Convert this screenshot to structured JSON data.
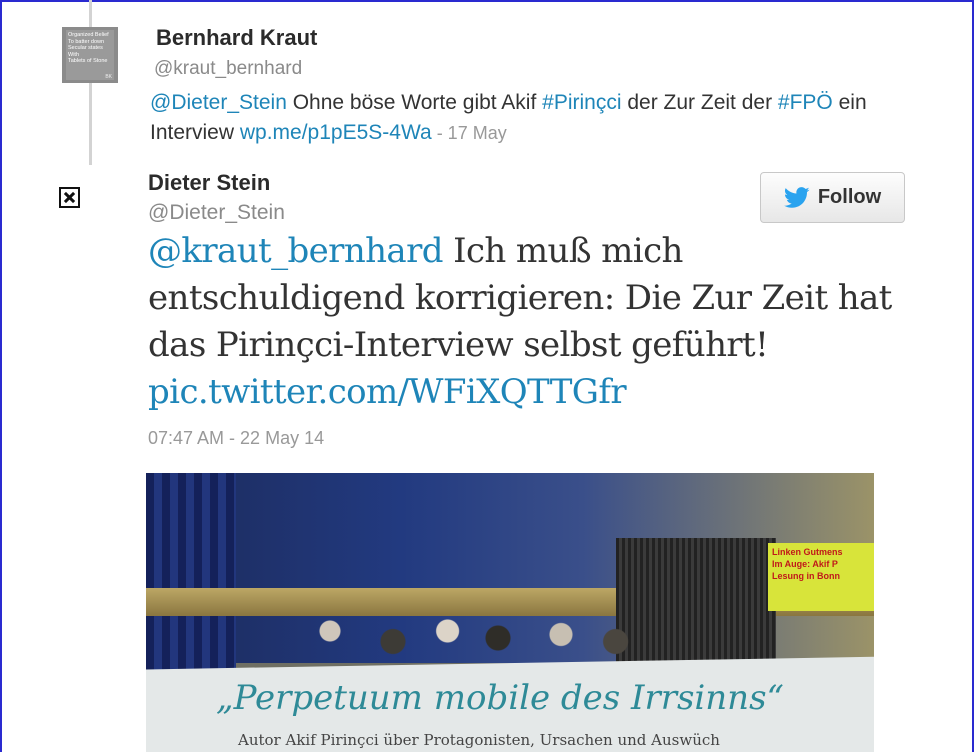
{
  "reply_tweet": {
    "avatar_lines": [
      "Organized Belief",
      "To batter down",
      "Secular states",
      "With",
      "Tablets of Stone"
    ],
    "avatar_initials": "BK",
    "name": "Bernhard Kraut",
    "handle": "@kraut_bernhard",
    "mention": "@Dieter_Stein",
    "text_1": " Ohne böse Worte gibt Akif ",
    "hashtag_1": "#Pirinçci",
    "text_2": " der Zur Zeit der ",
    "hashtag_2": "#FPÖ",
    "text_3": " ein Interview ",
    "link": "wp.me/p1pE5S-4Wa",
    "date": " - 17 May"
  },
  "main_tweet": {
    "name": "Dieter Stein",
    "handle": "@Dieter_Stein",
    "follow_label": "Follow",
    "mention": "@kraut_bernhard",
    "text": " Ich muß mich entschuldigend korrigieren: Die Zur Zeit hat das Pirinçci-Interview selbst geführt! ",
    "pic_link": "pic.twitter.com/WFiXQTTGfr",
    "timestamp": "07:47 AM - 22 May 14"
  },
  "photo": {
    "caption_lines": [
      "Linken Gutmens",
      "Im Auge: Akif P",
      "Lesung in Bonn"
    ],
    "headline": "„Perpetuum mobile des Irrsinns“",
    "subline": "Autor Akif Pirinçci über Protagonisten, Ursachen und Auswüch"
  },
  "colors": {
    "link": "#1e85b8",
    "twitter_blue": "#2aa3ef"
  }
}
